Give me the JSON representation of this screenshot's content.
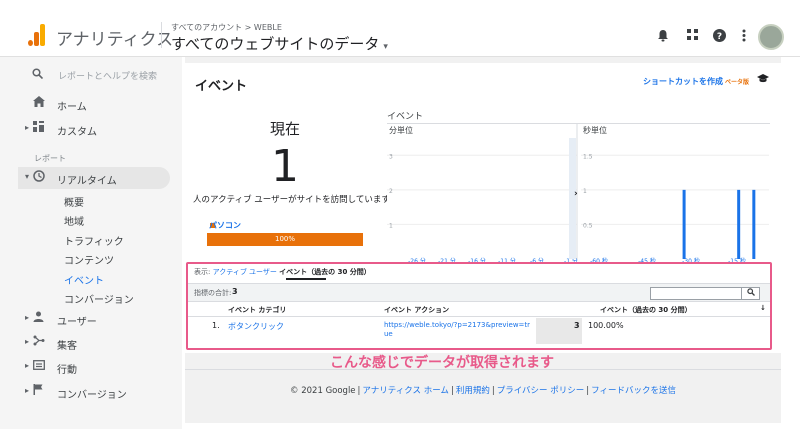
{
  "app": {
    "name": "アナリティクス",
    "breadcrumb": "すべてのアカウント > WEBLE",
    "property": "すべてのウェブサイトのデータ",
    "property_caret": "▾"
  },
  "topbar": {
    "icons": [
      "bell-icon",
      "apps-icon",
      "help-icon",
      "more-icon",
      "avatar"
    ],
    "bell": "🔔",
    "apps": "⠿",
    "help": "?",
    "more": "⋮"
  },
  "sidebar": {
    "search_placeholder": "レポートとヘルプを検索",
    "home": "ホーム",
    "custom": "カスタム",
    "reports_label": "レポート",
    "realtime": "リアルタイム",
    "realtime_sub": [
      "概要",
      "地域",
      "トラフィック",
      "コンテンツ",
      "イベント",
      "コンバージョン"
    ],
    "realtime_selected": "イベント",
    "users": "ユーザー",
    "acquisition": "集客",
    "behavior": "行動",
    "conversions": "コンバージョン"
  },
  "report": {
    "title": "イベント",
    "shortcut": "ショートカットを作成",
    "beta": "ベータ版",
    "now_label": "現在",
    "active_count": "1",
    "visit_text": "人のアクティブ ユーザーがサイトを訪問しています",
    "device": "パソコン",
    "device_pct": "100%",
    "device_share": 1.0,
    "chart_title": "イベント"
  },
  "chart_data": [
    {
      "type": "bar",
      "title": "分単位",
      "xlabel": "",
      "ylabel": "",
      "ylim": [
        0,
        3.5
      ],
      "yticks": [
        "3",
        "2",
        "1"
      ],
      "xticks": [
        "-26 分",
        "-21 分",
        "-16 分",
        "-11 分",
        "-6 分",
        "-1 分"
      ],
      "x": [
        -1
      ],
      "values": [
        3
      ],
      "color": "#1a73e8",
      "grid": true
    },
    {
      "type": "bar",
      "title": "秒単位",
      "xlabel": "",
      "ylabel": "",
      "ylim": [
        0,
        1.75
      ],
      "yticks": [
        "1.5",
        "1",
        "0.5"
      ],
      "xticks": [
        "-60 秒",
        "-45 秒",
        "-30 秒",
        "-15 秒"
      ],
      "x": [
        -28,
        -10,
        -5
      ],
      "values": [
        1,
        1,
        1
      ],
      "color": "#1a73e8",
      "grid": true
    }
  ],
  "table": {
    "filter_prefix": "表示:",
    "filter_link": "アクティブ ユーザー",
    "filter_active": "イベント（過去の 30 分間）",
    "totals_label": "指標の合計:",
    "totals_value": "3",
    "search_btn": "🔍",
    "headers": [
      "イベント カテゴリ",
      "イベント アクション",
      "イベント（過去の 30 分間）"
    ],
    "sort_icon": "↓",
    "rows": [
      {
        "index": "1.",
        "category": "ボタンクリック",
        "action": "https://weble.tokyo/?p=2173&preview=true",
        "count": "3",
        "percent": "100.00%"
      }
    ]
  },
  "annotation": "こんな感じでデータが取得されます",
  "footer": {
    "copyright": "© 2021 Google",
    "links": [
      "アナリティクス ホーム",
      "利用規約",
      "プライバシー ポリシー",
      "フィードバックを送信"
    ]
  }
}
